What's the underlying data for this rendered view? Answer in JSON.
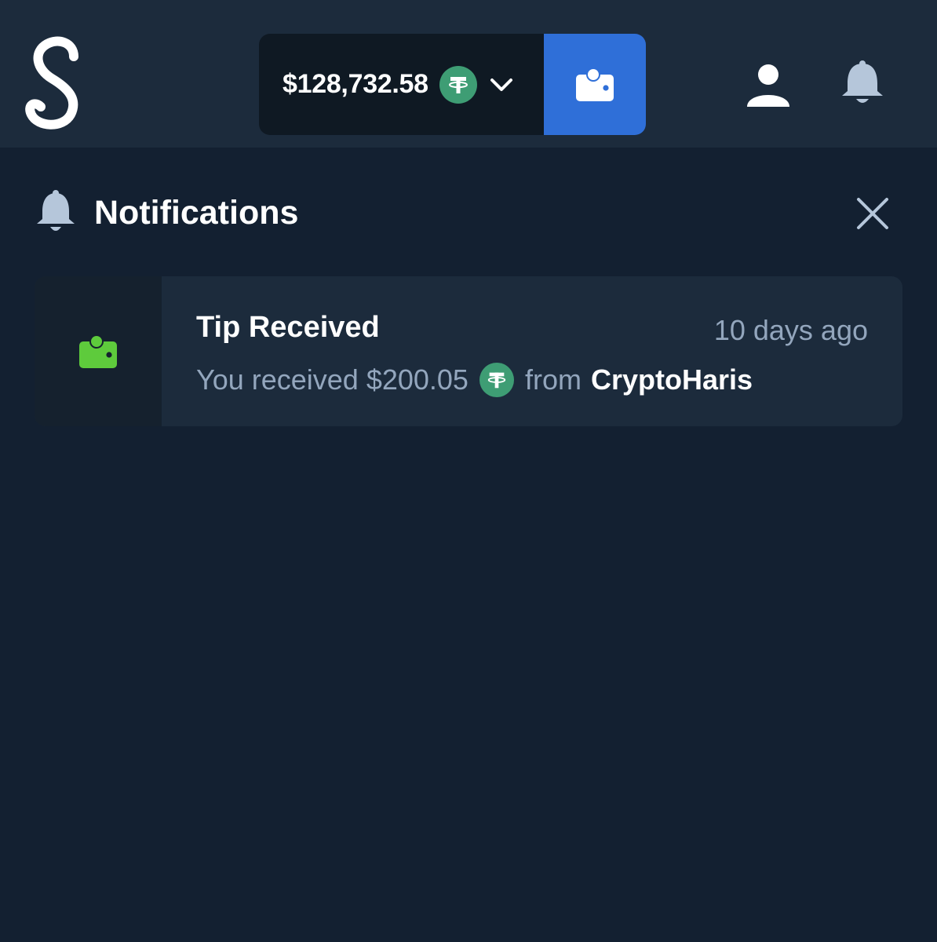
{
  "header": {
    "balance": "$128,732.58",
    "currency_icon": "tether-icon",
    "colors": {
      "topbar": "#1c2b3c",
      "wallet_button": "#2f6fd8",
      "coin": "#3e9d74"
    }
  },
  "notifications_panel": {
    "title": "Notifications",
    "items": [
      {
        "title": "Tip Received",
        "time": "10 days ago",
        "message_prefix": "You received $200.05",
        "message_from": "from",
        "sender": "CryptoHaris",
        "icon": "wallet-icon",
        "icon_color": "#5ecb3c"
      }
    ]
  }
}
